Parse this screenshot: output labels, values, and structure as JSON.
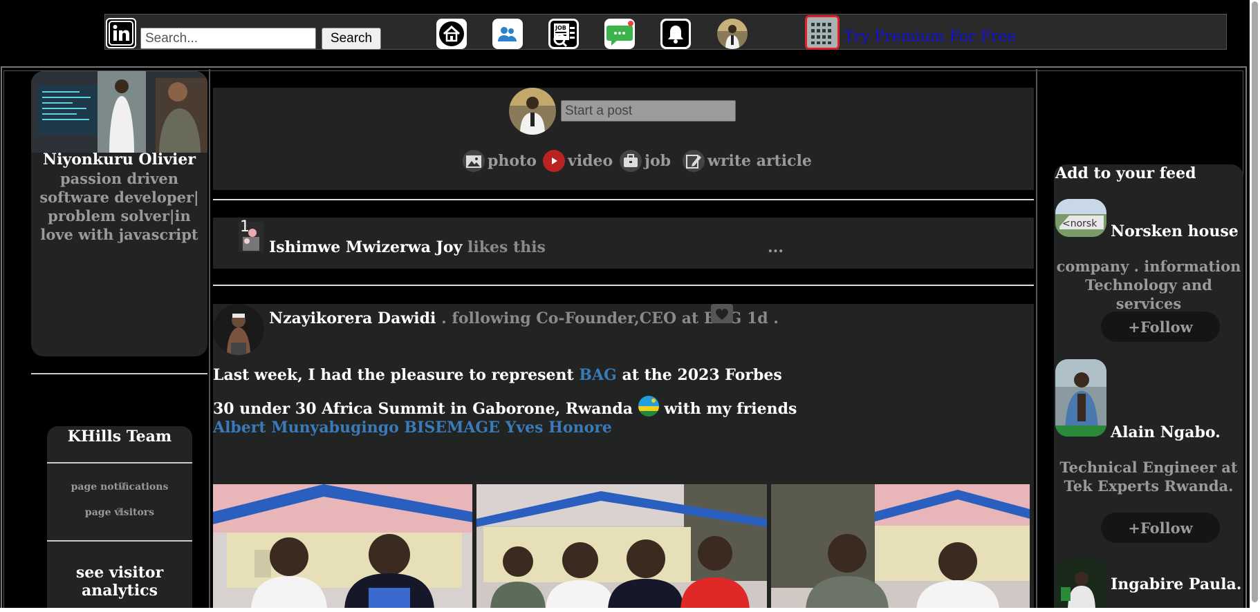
{
  "nav": {
    "search_placeholder": "Search...",
    "search_button": "Search",
    "icons": [
      "home-icon",
      "network-icon",
      "jobs-icon",
      "messaging-icon",
      "notifications-icon"
    ],
    "premium_link": "Try Premium For Free"
  },
  "profile": {
    "name": "Niyonkuru Olivier",
    "bio": "passion driven software developer| problem solver|in love with javascript"
  },
  "team": {
    "title": "KHills Team",
    "page_notifications": "page notifications",
    "page_notifications_count": "2",
    "page_visitors": "page visitors",
    "page_visitors_count": "3",
    "analytics_link": "see visitor analytics"
  },
  "composer": {
    "placeholder": "Start a post",
    "actions": {
      "photo": "photo",
      "video": "video",
      "job": "job",
      "article": "write article"
    }
  },
  "activity": {
    "user": "Ishimwe Mwizerwa Joy",
    "action": "likes this",
    "more": "..."
  },
  "post": {
    "author": "Nzayikorera Dawidi",
    "meta": ". following Co-Founder,CEO at BAG 1d .",
    "line1_a": "Last week, I had the pleasure to represent",
    "line1_link": "BAG",
    "line1_b": "at the 2023 Forbes",
    "line2_a": "30 under 30 Africa Summit in Gaborone, Rwanda",
    "line2_b": "with my friends",
    "line3_links": "Albert Munyabugingo BISEMAGE Yves Honore"
  },
  "feed": {
    "title": "Add to your feed",
    "items": [
      {
        "name": "Norsken house",
        "desc": "company . information Technology and services",
        "follow": "+Follow"
      },
      {
        "name": "Alain Ngabo.",
        "desc": "Technical Engineer at Tek Experts Rwanda.",
        "follow": "+Follow"
      },
      {
        "name": "Ingabire Paula."
      }
    ]
  },
  "colors": {
    "background": "#000000",
    "card": "#222424",
    "link": "#3a7ab8",
    "premium": "#1010d8",
    "muted": "#9a9a9a"
  }
}
